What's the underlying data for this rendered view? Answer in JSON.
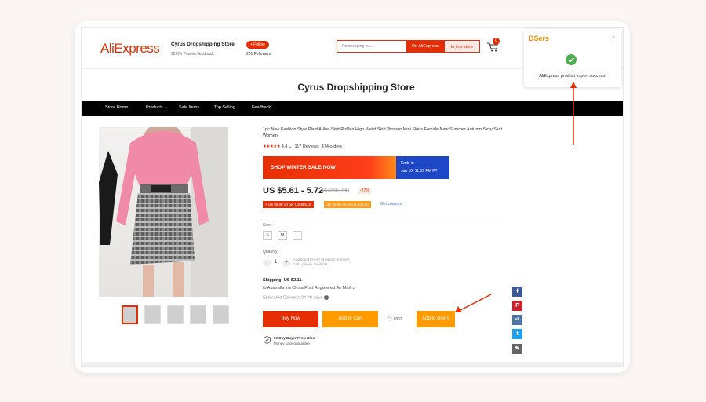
{
  "header": {
    "logo": "AliExpress",
    "store_name": "Cyrus Dropshipping Store",
    "store_feedback": "92.6% Positive feedback",
    "follow": "+ Follow",
    "followers": "201 Followers",
    "search_placeholder": "I'm shopping for...",
    "search_on": "On AliExpress",
    "search_store": "In this store",
    "cart_count": "0"
  },
  "store_title": "Cyrus Dropshipping Store",
  "nav": [
    "Store Home",
    "Products ⌄",
    "Sale Items",
    "Top Selling",
    "Feedback"
  ],
  "product": {
    "title": "1pc New Fashion Style Plaid A-line Skirt Ruffles High Waist Skirt Women Mini Skirts Female New Summer Autumn Sexy Skirt Women",
    "stars": "★★★★★",
    "rating": "4.4 ⌄",
    "reviews": "117 Reviews",
    "orders": "474 orders",
    "sale_banner": "SHOP WINTER SALE NOW",
    "ends_label": "Ends in",
    "ends_date": "Jan 10, 11:59 PM PT",
    "price": "US $5.61 - 5.72",
    "old_price": "US $7.65 - 7.84",
    "discount": "-27%",
    "coupon1": "< US $6.00 off per US $65.00",
    "coupon2": "US $1.00 off on US $20.00",
    "coupon_link": "Get coupons",
    "size_label": "Size:",
    "sizes": [
      "S",
      "M",
      "L"
    ],
    "qty_label": "Quantity:",
    "qty_minus": "-",
    "qty_value": "1",
    "qty_plus": "+",
    "qty_note_1": "Additional 5% off (3 pieces or more)",
    "qty_note_2": "2491 pieces available",
    "shipping": "Shipping: US $2.11",
    "shipping_to": "to Australia via China Post Registered Air Mail ⌄",
    "delivery": "Estimated Delivery: 24-49 days",
    "buy_now": "Buy Now",
    "add_to_cart": "Add to Cart",
    "wishlist_count": "6962",
    "add_to_dsers": "Add to Dsers",
    "protection_title": "60-Day Buyer Protection",
    "protection_sub": "Money back guarantee"
  },
  "social": [
    {
      "icon": "facebook-icon",
      "label": "f",
      "color": "#3b5998"
    },
    {
      "icon": "pinterest-icon",
      "label": "P",
      "color": "#cb2027"
    },
    {
      "icon": "vk-icon",
      "label": "vk",
      "color": "#4c75a3"
    },
    {
      "icon": "twitter-icon",
      "label": "t",
      "color": "#1da1f2"
    },
    {
      "icon": "edit-icon",
      "label": "✎",
      "color": "#666666"
    }
  ],
  "popup": {
    "title": "DSers",
    "close": "×",
    "message": "AliExpress product import success!"
  },
  "colors": {
    "accent": "#e62e04",
    "orange": "#ff9a00",
    "dsers_orange": "#ff8a00",
    "blue": "#1e47c8",
    "success": "#4caf50",
    "annotation_arrow": "#e62e04"
  }
}
